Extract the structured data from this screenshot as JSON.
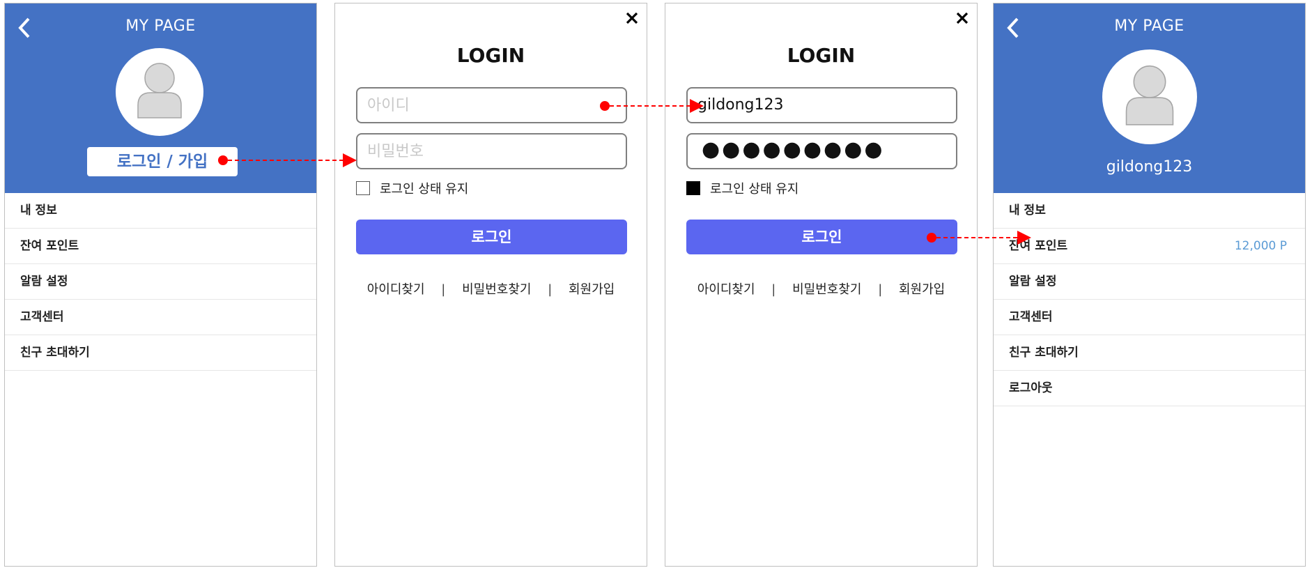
{
  "screens": {
    "mypage_guest": {
      "title": "MY PAGE",
      "login_button": "로그인 / 가입",
      "menu": [
        "내 정보",
        "잔여 포인트",
        "알람 설정",
        "고객센터",
        "친구 초대하기"
      ]
    },
    "login_empty": {
      "title": "LOGIN",
      "id_placeholder": "아이디",
      "pw_placeholder": "비밀번호",
      "remember_label": "로그인 상태 유지",
      "remember_checked": false,
      "login_button": "로그인",
      "links": [
        "아이디찾기",
        "비밀번호찾기",
        "회원가입"
      ],
      "separator": "|"
    },
    "login_filled": {
      "title": "LOGIN",
      "id_value": "gildong123",
      "pw_value": "●●●●●●●●●",
      "remember_label": "로그인 상태 유지",
      "remember_checked": true,
      "login_button": "로그인",
      "links": [
        "아이디찾기",
        "비밀번호찾기",
        "회원가입"
      ],
      "separator": "|"
    },
    "mypage_user": {
      "title": "MY PAGE",
      "username": "gildong123",
      "menu": [
        "내 정보",
        "잔여 포인트",
        "알람 설정",
        "고객센터",
        "친구 초대하기",
        "로그아웃"
      ],
      "points_value": "12,000 P"
    }
  },
  "colors": {
    "header_blue": "#4472c4",
    "login_button": "#5b66f0",
    "points_text": "#5b9bd5",
    "flow_arrow": "#ff0000"
  }
}
